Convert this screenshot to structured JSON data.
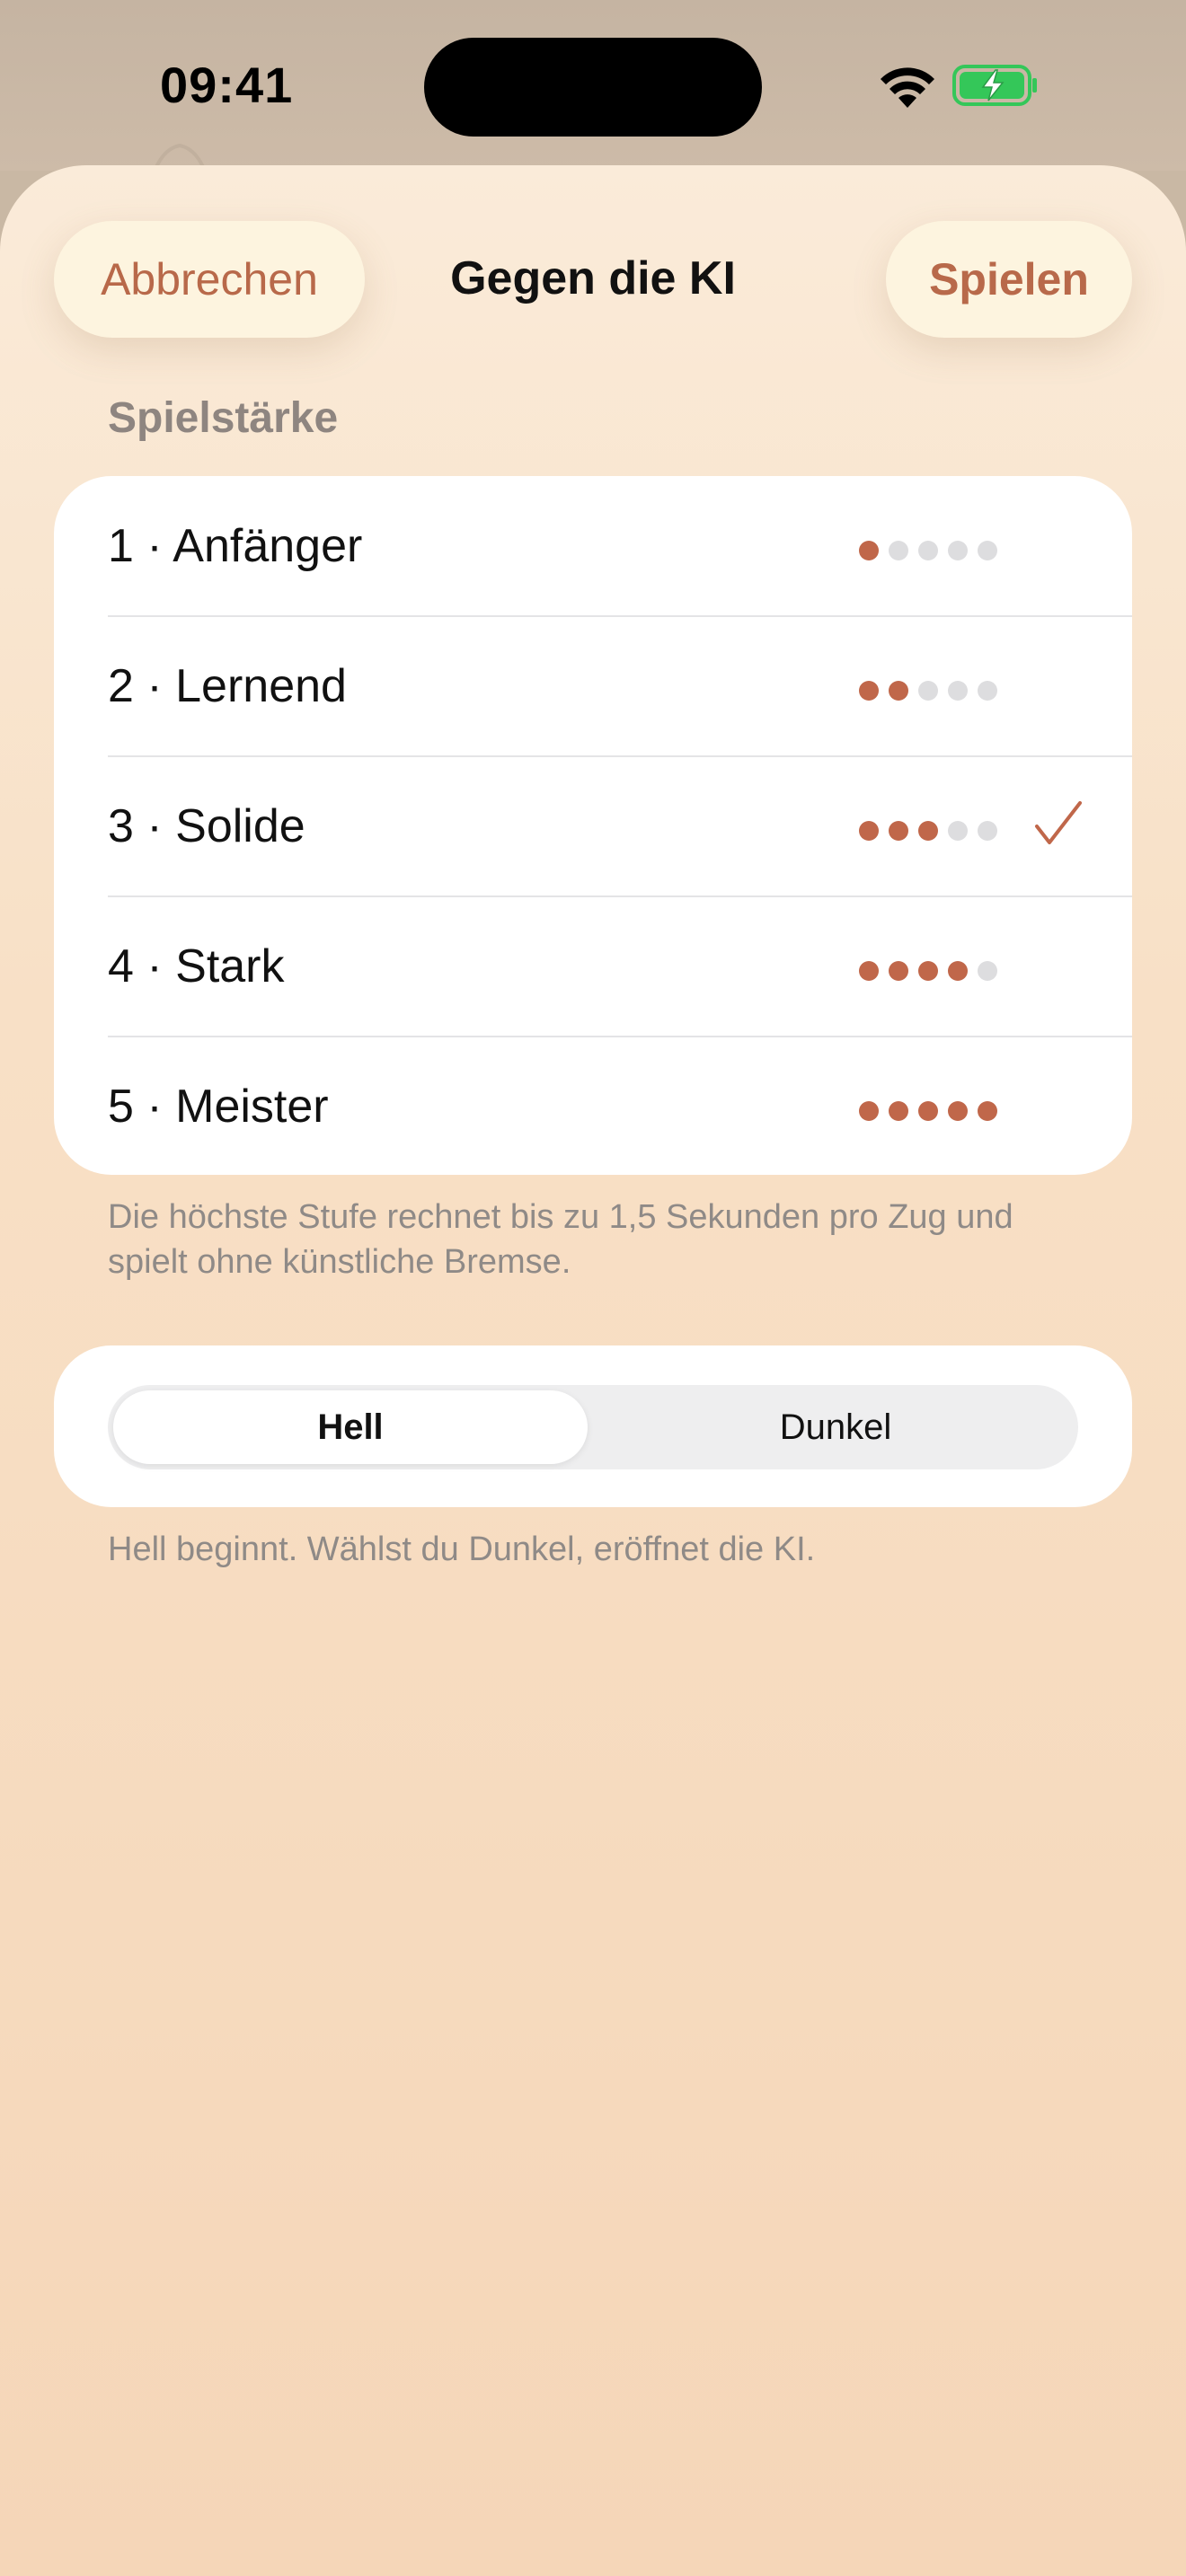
{
  "status_bar": {
    "time": "09:41",
    "icons": [
      "wifi-icon",
      "battery-charging-icon"
    ],
    "battery_color": "#34c759"
  },
  "nav": {
    "cancel_label": "Abbrechen",
    "title": "Gegen die KI",
    "play_label": "Spielen"
  },
  "levels": {
    "header": "Spielstärke",
    "selected_index": 2,
    "items": [
      {
        "label": "1 · Anfänger",
        "strength": 1,
        "selected": false
      },
      {
        "label": "2 · Lernend",
        "strength": 2,
        "selected": false
      },
      {
        "label": "3 · Solide",
        "strength": 3,
        "selected": true
      },
      {
        "label": "4 · Stark",
        "strength": 4,
        "selected": false
      },
      {
        "label": "5 · Meister",
        "strength": 5,
        "selected": false
      }
    ],
    "max_strength": 5,
    "footnote": "Die höchste Stufe rechnet bis zu 1,5 Sekunden pro Zug und spielt ohne künstliche Bremse."
  },
  "side": {
    "options": [
      "Hell",
      "Dunkel"
    ],
    "selected": "Hell",
    "footnote": "Hell beginnt. Wählst du Dunkel, eröffnet die KI."
  },
  "colors": {
    "accent": "#b8694a",
    "dot_active": "#c0674a",
    "dot_inactive": "#dddddf",
    "checkmark": "#c0674a"
  }
}
